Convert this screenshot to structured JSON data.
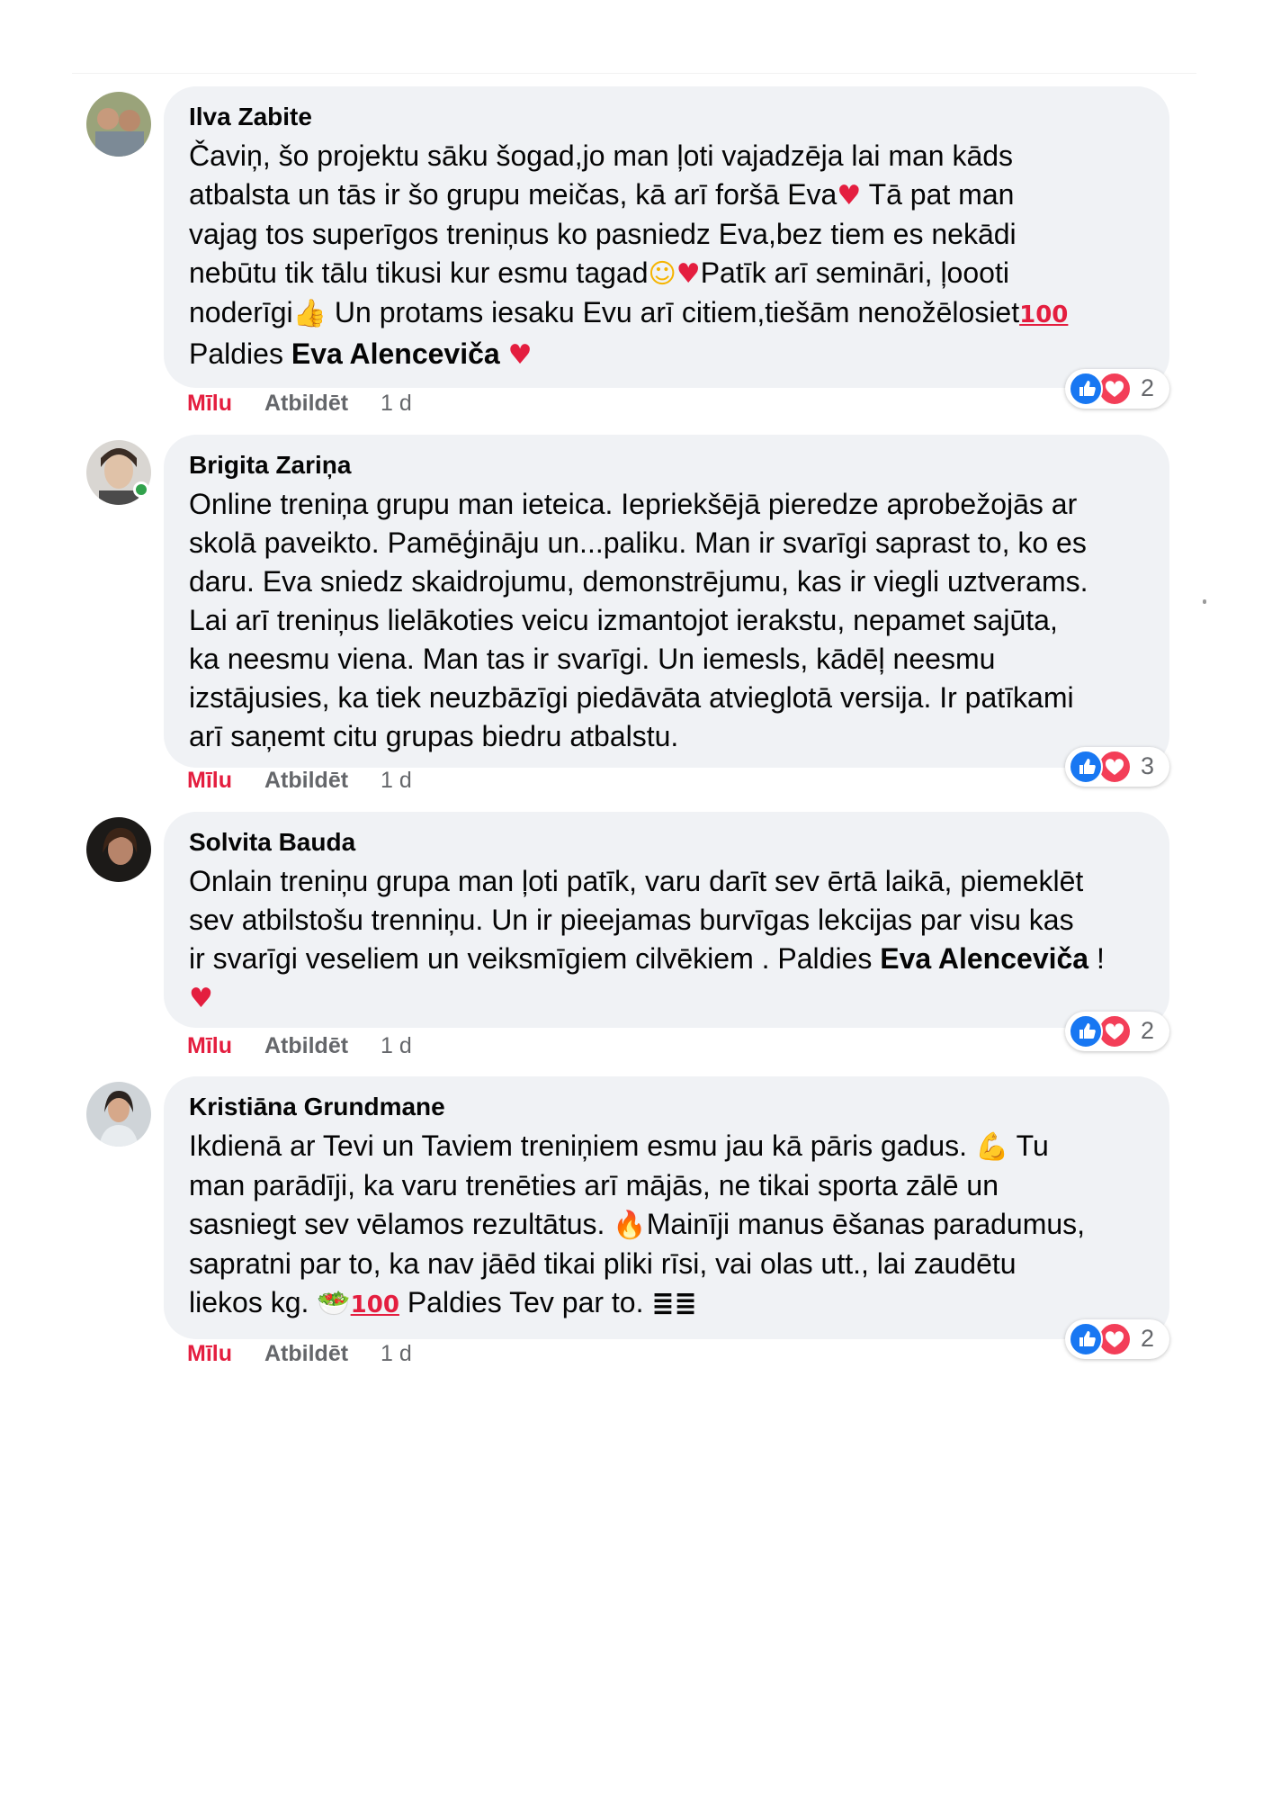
{
  "comments": [
    {
      "author": "Ilva Zabite",
      "text": {
        "l1": "Čaviņ, šo projektu sāku šogad,jo man ļoti vajadzēja lai man kāds",
        "l2a": "atbalsta un tās ir šo grupu meičas, kā arī foršā Eva",
        "l2b": " Tā pat man",
        "l3": "vajag tos superīgos treniņus ko pasniedz Eva,bez tiem es nekādi",
        "l4a": "nebūtu tik tālu tikusi kur esmu tagad",
        "l4b": "Patīk arī semināri, ļoooti",
        "l5a": "noderīgi",
        "l5b": " Un protams iesaku Evu arī citiem,tiešām nenožēlosiet",
        "l6a": "Paldies ",
        "l6mention": "Eva Alenceviča",
        "l6b": " "
      },
      "emojis": {
        "heart": "♥",
        "smile": "☺",
        "thumbs_up": "👍",
        "hundred": "100"
      },
      "actions": {
        "like": "Mīlu",
        "reply": "Atbildēt",
        "time": "1 d"
      },
      "reactions": {
        "count": "2",
        "icons": [
          "like-icon",
          "love-icon"
        ]
      }
    },
    {
      "author": "Brigita Zariņa",
      "online": true,
      "text": {
        "l1": "Online treniņa grupu man ieteica. Iepriekšējā pieredze aprobežojās ar",
        "l2": "skolā paveikto. Pamēģināju un...paliku. Man ir svarīgi saprast to, ko es",
        "l3": "daru. Eva sniedz skaidrojumu, demonstrējumu, kas ir viegli uztverams.",
        "l4": "Lai arī treniņus lielākoties veicu izmantojot ierakstu, nepamet sajūta,",
        "l5": "ka neesmu viena. Man tas ir svarīgi. Un iemesls, kādēļ neesmu",
        "l6": "izstājusies, ka tiek neuzbāzīgi piedāvāta atvieglotā versija. Ir patīkami",
        "l7": "arī saņemt citu grupas biedru atbalstu."
      },
      "actions": {
        "like": "Mīlu",
        "reply": "Atbildēt",
        "time": "1 d"
      },
      "reactions": {
        "count": "3",
        "icons": [
          "like-icon",
          "love-icon"
        ]
      }
    },
    {
      "author": "Solvita Bauda",
      "text": {
        "l1": "Onlain treniņu grupa man ļoti patīk, varu darīt sev ērtā laikā, piemeklēt",
        "l2": "sev atbilstošu trenniņu. Un ir pieejamas burvīgas lekcijas par visu kas",
        "l3a": "ir svarīgi veseliem un veiksmīgiem cilvēkiem . Paldies ",
        "l3mention": "Eva Alenceviča",
        "l3b": " !"
      },
      "emojis": {
        "heart": "♥"
      },
      "actions": {
        "like": "Mīlu",
        "reply": "Atbildēt",
        "time": "1 d"
      },
      "reactions": {
        "count": "2",
        "icons": [
          "like-icon",
          "love-icon"
        ]
      }
    },
    {
      "author": "Kristiāna Grundmane",
      "text": {
        "l1a": "Ikdienā ar Tevi un Taviem treniņiem esmu jau kā pāris gadus. ",
        "l1b": " Tu",
        "l2": "man parādīji, ka varu trenēties arī mājās, ne tikai sporta zālē un",
        "l3a": "sasniegt sev vēlamos rezultātus. ",
        "l3b": "Mainīji manus ēšanas paradumus,",
        "l4": "sapratni par to, ka nav jāēd tikai pliki rīsi, vai olas utt., lai zaudētu",
        "l5a": "liekos kg. ",
        "l5b": " Paldies Tev par to. "
      },
      "emojis": {
        "muscle": "💪",
        "fire": "🔥",
        "salad": "🥗",
        "hundred": "100",
        "flag": "≣≣"
      },
      "actions": {
        "like": "Mīlu",
        "reply": "Atbildēt",
        "time": "1 d"
      },
      "reactions": {
        "count": "2",
        "icons": [
          "like-icon",
          "love-icon"
        ]
      }
    }
  ],
  "colors": {
    "bubble": "#f0f2f5",
    "like_action": "#e41e3f",
    "secondary_text": "#65676b",
    "like_reaction": "#1877f2",
    "love_reaction": "#f33e58",
    "online": "#31a24c"
  }
}
